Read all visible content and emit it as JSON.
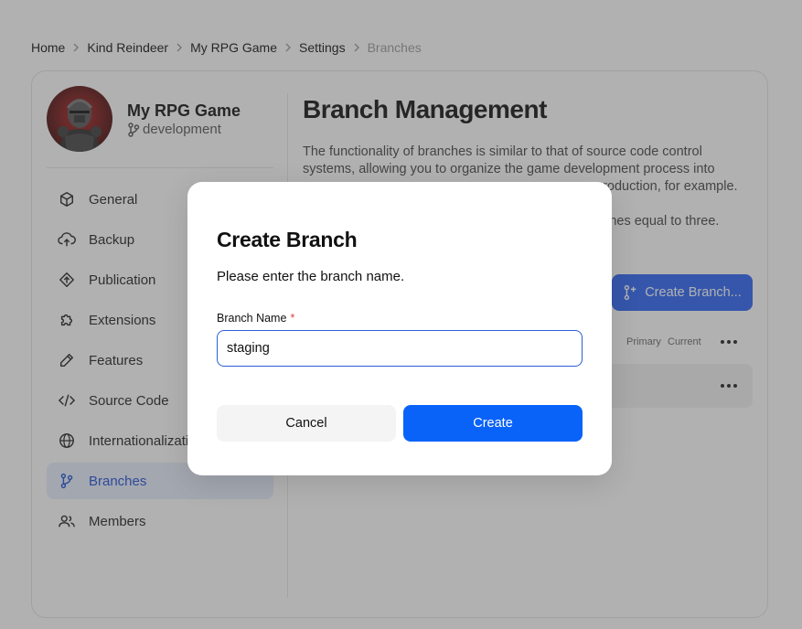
{
  "breadcrumb": {
    "items": [
      "Home",
      "Kind Reindeer",
      "My RPG Game",
      "Settings",
      "Branches"
    ]
  },
  "project": {
    "name": "My RPG Game",
    "branch": "development"
  },
  "sidebar": {
    "items": [
      {
        "label": "General",
        "icon": "cube-icon"
      },
      {
        "label": "Backup",
        "icon": "cloud-upload-icon"
      },
      {
        "label": "Publication",
        "icon": "publish-icon"
      },
      {
        "label": "Extensions",
        "icon": "puzzle-icon"
      },
      {
        "label": "Features",
        "icon": "pencil-icon"
      },
      {
        "label": "Source Code",
        "icon": "code-icon"
      },
      {
        "label": "Internationalization",
        "icon": "globe-icon"
      },
      {
        "label": "Branches",
        "icon": "branch-icon",
        "active": true
      },
      {
        "label": "Members",
        "icon": "users-icon"
      }
    ]
  },
  "main": {
    "title": "Branch Management",
    "desc_line1": "The functionality of branches is similar to that of source code control",
    "desc_line2": "systems, allowing you to organize the game development process into",
    "desc_line3": "production, for example.",
    "desc_line4": "nches equal to three.",
    "create_button": "Create Branch...",
    "col_primary": "Primary",
    "col_current": "Current"
  },
  "modal": {
    "title": "Create Branch",
    "subtitle": "Please enter the branch name.",
    "field_label": "Branch Name",
    "required_mark": "*",
    "field_value": "staging",
    "cancel": "Cancel",
    "create": "Create"
  },
  "colors": {
    "accent": "#0a63f8",
    "active_nav_bg": "#e7eefb",
    "active_nav_text": "#1d4fd8",
    "required": "#e04040"
  }
}
